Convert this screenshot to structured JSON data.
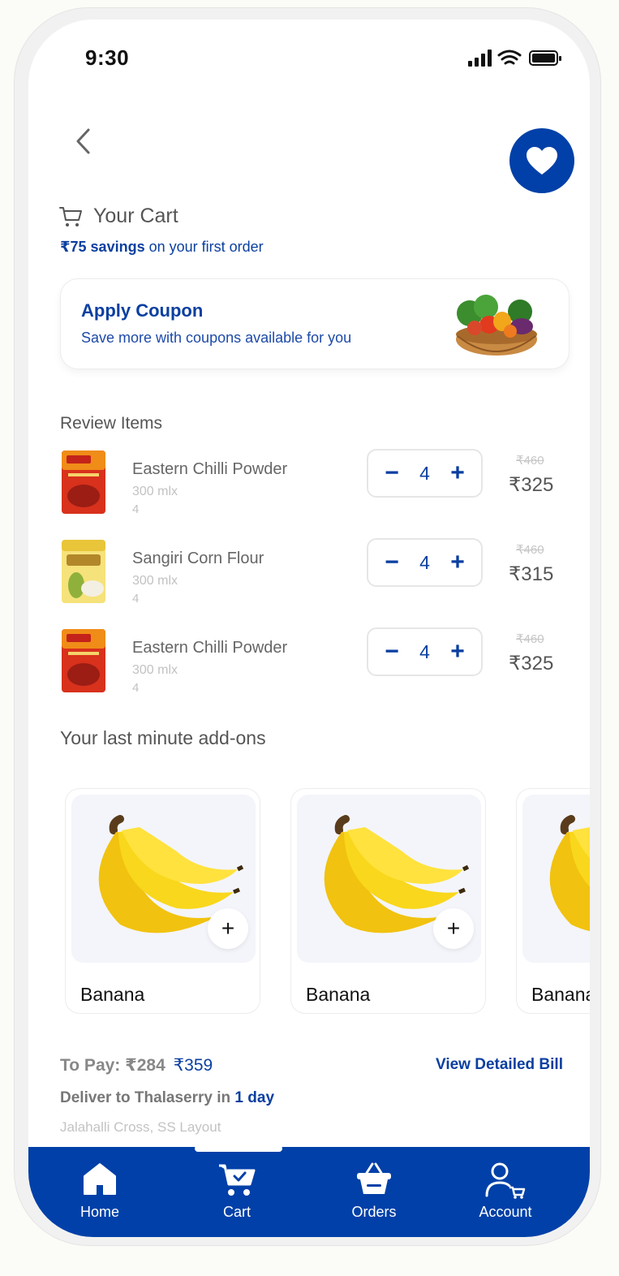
{
  "status": {
    "time": "9:30"
  },
  "cart": {
    "title": "Your Cart",
    "savings_amount": "₹75 savings",
    "savings_text": " on your first order"
  },
  "coupon": {
    "title": "Apply Coupon",
    "subtitle": "Save more with coupons available for you"
  },
  "review": {
    "title": "Review Items",
    "items": [
      {
        "name": "Eastern Chilli Powder",
        "size": "300 mlx",
        "qty": "4",
        "stepper_qty": "4",
        "old_price": "₹460",
        "price": "₹325"
      },
      {
        "name": "Sangiri Corn Flour",
        "size": "300 mlx",
        "qty": "4",
        "stepper_qty": "4",
        "old_price": "₹460",
        "price": "₹315"
      },
      {
        "name": "Eastern Chilli Powder",
        "size": "300 mlx",
        "qty": "4",
        "stepper_qty": "4",
        "old_price": "₹460",
        "price": "₹325"
      }
    ],
    "minus": "−",
    "plus": "+"
  },
  "addons": {
    "title": "Your last minute add-ons",
    "items": [
      {
        "name": "Banana"
      },
      {
        "name": "Banana"
      },
      {
        "name": "Banana"
      }
    ],
    "add": "+"
  },
  "bill": {
    "to_pay": "To Pay: ₹284",
    "original": "₹359",
    "view_bill": "View Detailed Bill",
    "deliver_prefix": "Deliver to Thalaserry in ",
    "deliver_days": "1 day",
    "address": "Jalahalli Cross, SS Layout"
  },
  "nav": {
    "items": [
      {
        "label": "Home",
        "icon": "home-icon"
      },
      {
        "label": "Cart",
        "icon": "cart-icon"
      },
      {
        "label": "Orders",
        "icon": "basket-icon"
      },
      {
        "label": "Account",
        "icon": "account-icon"
      }
    ],
    "active": "Cart"
  },
  "colors": {
    "brand": "#0040a8",
    "text_muted": "#555555"
  }
}
